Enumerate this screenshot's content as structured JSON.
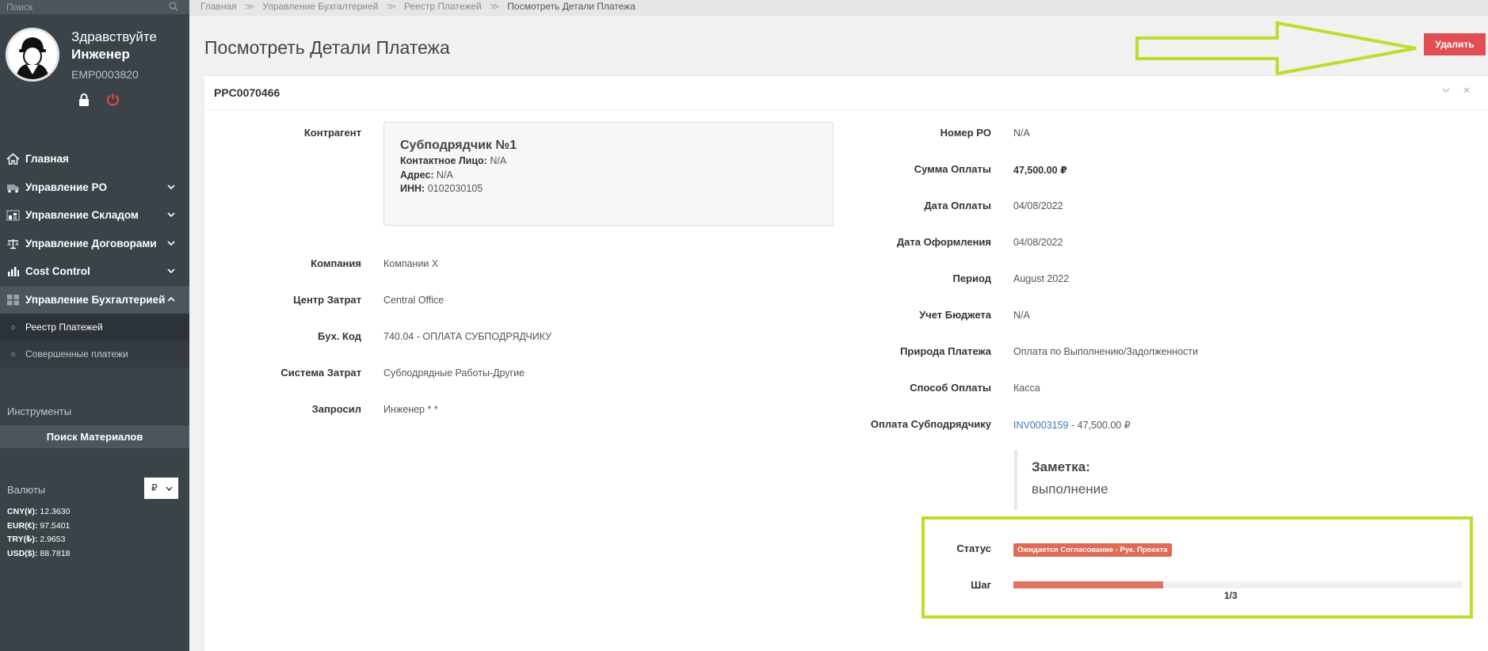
{
  "sidebar": {
    "search_placeholder": "Поиск",
    "greeting": "Здравствуйте",
    "username": "Инженер",
    "employee_id": "EMP0003820",
    "nav": [
      {
        "label": "Главная"
      },
      {
        "label": "Управление PO"
      },
      {
        "label": "Управление Складом"
      },
      {
        "label": "Управление Договорами"
      },
      {
        "label": "Cost Control"
      },
      {
        "label": "Управление Бухгалтерией"
      }
    ],
    "subnav": [
      {
        "label": "Реестр Платежей"
      },
      {
        "label": "Совершенные платежи"
      }
    ],
    "tools_title": "Инструменты",
    "tools_button": "Поиск Материалов",
    "currencies_title": "Валюты",
    "currency_selected": "₽",
    "rates": [
      {
        "code": "CNY(¥):",
        "value": "12.3630"
      },
      {
        "code": "EUR(€):",
        "value": "97.5401"
      },
      {
        "code": "TRY(₺):",
        "value": "2.9653"
      },
      {
        "code": "USD($):",
        "value": "88.7818"
      }
    ]
  },
  "breadcrumb": [
    "Главная",
    "Управление Бухгалтерией",
    "Реестр Платежей",
    "Посмотреть Детали Платежа"
  ],
  "page_title": "Посмотреть Детали Платежа",
  "delete_label": "Удалить",
  "card": {
    "id": "PPC0070466",
    "left": {
      "contractor_label": "Контрагент",
      "contractor": {
        "name": "Субподрядчик №1",
        "contact_label": "Контактное Лицо:",
        "contact": "N/A",
        "address_label": "Адрес:",
        "address": "N/A",
        "inn_label": "ИНН:",
        "inn": "0102030105"
      },
      "fields": [
        {
          "label": "Компания",
          "value": "Компании Х"
        },
        {
          "label": "Центр Затрат",
          "value": "Central Office"
        },
        {
          "label": "Бух. Код",
          "value": "740.04 - ОПЛАТА СУБПОДРЯДЧИКУ"
        },
        {
          "label": "Система Затрат",
          "value": "Субподрядные Работы-Другие"
        },
        {
          "label": "Запросил",
          "value": "Инженер * *"
        }
      ]
    },
    "right": {
      "fields": [
        {
          "label": "Номер PO",
          "value": "N/A"
        },
        {
          "label": "Сумма Оплаты",
          "value": "47,500.00 ₽"
        },
        {
          "label": "Дата Оплаты",
          "value": "04/08/2022"
        },
        {
          "label": "Дата Оформления",
          "value": "04/08/2022"
        },
        {
          "label": "Период",
          "value": "August 2022"
        },
        {
          "label": "Учет Бюджета",
          "value": "N/A"
        },
        {
          "label": "Природа Платежа",
          "value": "Оплата по Выполнению/Задолженности"
        },
        {
          "label": "Способ Оплаты",
          "value": "Касса"
        }
      ],
      "subcontractor_label": "Оплата Субподрядчику",
      "subcontractor_invoice": "INV0003159",
      "subcontractor_amount": " - 47,500.00 ₽",
      "note_title": "Заметка:",
      "note_text": "выполнение",
      "status_label": "Статус",
      "status_value": "Ожидается Согласование - Рук. Проекта",
      "step_label": "Шаг",
      "step_text": "1/3",
      "step_fraction": 0.333
    }
  },
  "colors": {
    "sidebar_bg": "#3a4348",
    "delete_button": "#e14f55",
    "status_badge": "#e06a55",
    "annotation": "#b8e02a"
  }
}
